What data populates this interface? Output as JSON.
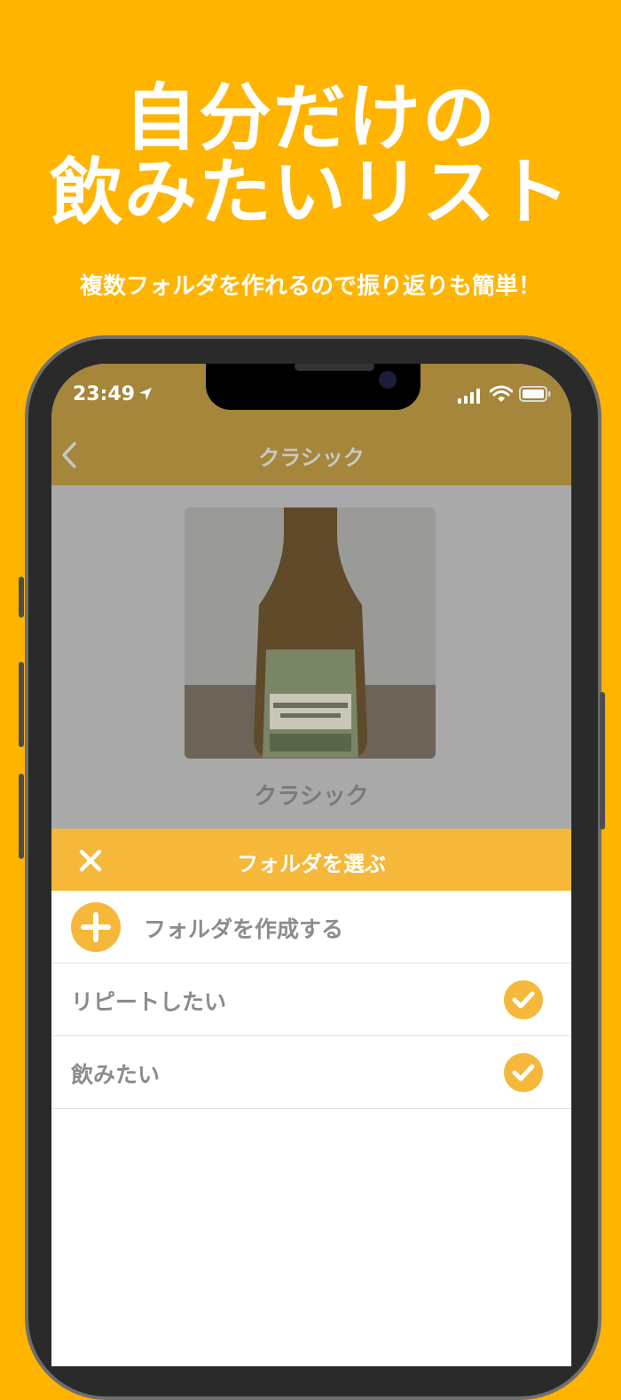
{
  "promo": {
    "headline_line1": "自分だけの",
    "headline_line2": "飲みたいリスト",
    "subline": "複数フォルダを作れるので振り返りも簡単！"
  },
  "status_bar": {
    "time": "23:49"
  },
  "nav": {
    "title": "クラシック"
  },
  "item": {
    "name": "クラシック"
  },
  "sheet": {
    "title": "フォルダを選ぶ",
    "create_label": "フォルダを作成する",
    "folders": [
      {
        "label": "リピートしたい",
        "checked": true
      },
      {
        "label": "飲みたい",
        "checked": true
      }
    ]
  },
  "colors": {
    "background": "#ffb400",
    "accent": "#f5b83a",
    "nav_dimmed": "#a5863a"
  },
  "icons": [
    "location-arrow-icon",
    "signal-icon",
    "wifi-icon",
    "battery-icon",
    "chevron-left-icon",
    "close-icon",
    "plus-icon",
    "check-icon"
  ]
}
